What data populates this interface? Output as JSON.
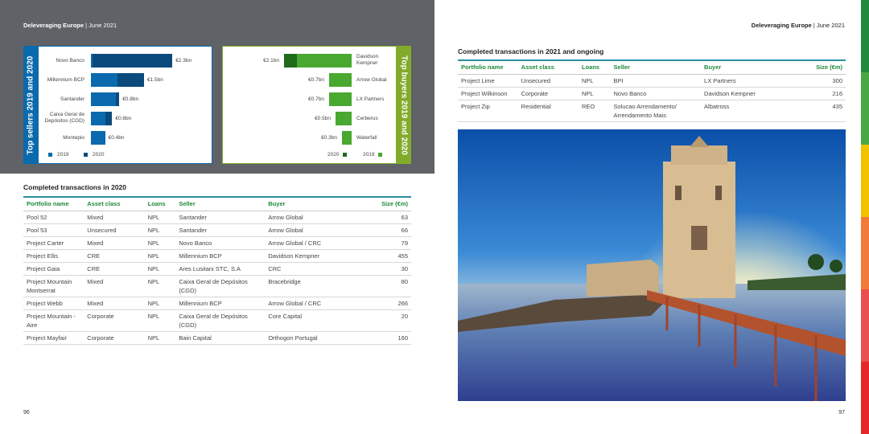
{
  "header": {
    "title": "Deleveraging Europe",
    "sep": "|",
    "date": "June 2021"
  },
  "page_left": "96",
  "page_right": "97",
  "sellers_chart": {
    "side_title": "Top sellers 2019 and 2020",
    "legend": [
      "2019",
      "2020"
    ],
    "rows": [
      {
        "label": "Novo Banco",
        "value": "€2.3bn",
        "v2019": 0.05,
        "v2020": 2.25
      },
      {
        "label": "Millennium BCP",
        "value": "€1.5bn",
        "v2019": 0.75,
        "v2020": 0.75
      },
      {
        "label": "Santander",
        "value": "€0.8bn",
        "v2019": 0.7,
        "v2020": 0.1
      },
      {
        "label": "Caixa Geral de Depósitos (CGD)",
        "value": "€0.6bn",
        "v2019": 0.4,
        "v2020": 0.2
      },
      {
        "label": "Montepio",
        "value": "€0.4bn",
        "v2019": 0.4,
        "v2020": 0.0
      }
    ]
  },
  "buyers_chart": {
    "side_title": "Top buyers 2019 and 2020",
    "legend": [
      "2020",
      "2019"
    ],
    "rows": [
      {
        "label": "Davidson Kempner",
        "value": "€2.1bn",
        "v2020": 0.4,
        "v2019": 1.7
      },
      {
        "label": "Arrow Global",
        "value": "€0.7bn",
        "v2020": 0.0,
        "v2019": 0.7
      },
      {
        "label": "LX Partners",
        "value": "€0.7bn",
        "v2020": 0.0,
        "v2019": 0.7
      },
      {
        "label": "Cerberus",
        "value": "€0.5bn",
        "v2020": 0.0,
        "v2019": 0.5
      },
      {
        "label": "Waterfall",
        "value": "€0.3bn",
        "v2020": 0.0,
        "v2019": 0.3
      }
    ]
  },
  "table2020": {
    "title": "Completed transactions in 2020",
    "headers": [
      "Portfolio name",
      "Asset class",
      "Loans",
      "Seller",
      "Buyer",
      "Size (€m)"
    ],
    "rows": [
      [
        "Pool 52",
        "Mixed",
        "NPL",
        "Santander",
        "Arrow Global",
        "63"
      ],
      [
        "Pool 53",
        "Unsecured",
        "NPL",
        "Santander",
        "Arrow Global",
        "66"
      ],
      [
        "Project Carter",
        "Mixed",
        "NPL",
        "Novo Banco",
        "Arrow Global / CRC",
        "79"
      ],
      [
        "Project Ellis",
        "CRE",
        "NPL",
        "Millennium BCP",
        "Davidson Kempner",
        "455"
      ],
      [
        "Project Gaia",
        "CRE",
        "NPL",
        "Ares Lusitani STC, S.A",
        "CRC",
        "30"
      ],
      [
        "Project Mountain Montserrat",
        "Mixed",
        "NPL",
        "Caixa Geral de Depósitos (CGD)",
        "Bracebridge",
        "80"
      ],
      [
        "Project Webb",
        "Mixed",
        "NPL",
        "Millennium BCP",
        "Arrow Global / CRC",
        "266"
      ],
      [
        "Project Mountain - Aire",
        "Corporate",
        "NPL",
        "Caixa Geral de Depósitos (CGD)",
        "Core Capital",
        "20"
      ],
      [
        "Project Mayfair",
        "Corporate",
        "NPL",
        "Bain Capital",
        "Orthogon Portugal",
        "160"
      ]
    ]
  },
  "table2021": {
    "title": "Completed transactions in 2021 and ongoing",
    "headers": [
      "Portfolio name",
      "Asset class",
      "Loans",
      "Seller",
      "Buyer",
      "Size (€m)"
    ],
    "rows": [
      [
        "Project Lime",
        "Unsecured",
        "NPL",
        "BPI",
        "LX Partners",
        "300"
      ],
      [
        "Project Wilkinson",
        "Corporate",
        "NPL",
        "Novo Banco",
        "Davidson Kempner",
        "216"
      ],
      [
        "Project Zip",
        "Residential",
        "REO",
        "Solucao Arrendamento/ Arrendamento Mais",
        "Albatross",
        "435"
      ]
    ]
  },
  "colors": {
    "blue": "#0a6aad",
    "navy": "#0b4a7c",
    "green_light": "#49a830",
    "green_dark": "#1e6b1a",
    "olive": "#82ab2b",
    "teal": "#2a8fa0",
    "gray": "#5f6266"
  }
}
